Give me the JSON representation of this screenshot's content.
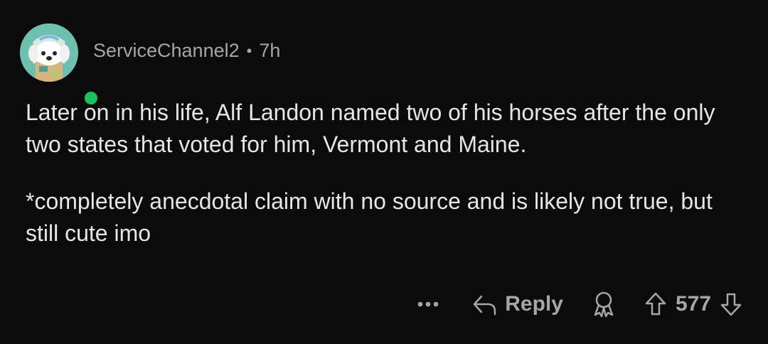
{
  "comment": {
    "author": "ServiceChannel2",
    "separator": "•",
    "time": "7h",
    "paragraphs": [
      "Later on in his life, Alf Landon named two of his horses after the only two states that voted for him, Vermont and Maine.",
      "*completely anecdotal claim with no source and is likely not true, but still cute imo"
    ]
  },
  "actions": {
    "more": "•••",
    "reply_label": "Reply",
    "vote_count": "577"
  },
  "icons": {
    "more": "more-options-icon",
    "reply": "reply-arrow-icon",
    "award": "award-icon",
    "upvote": "upvote-arrow-icon",
    "downvote": "downvote-arrow-icon"
  },
  "colors": {
    "background": "#0b0b0b",
    "text": "#e4e6e7",
    "muted": "#a4a7a9",
    "online": "#19c15f"
  }
}
